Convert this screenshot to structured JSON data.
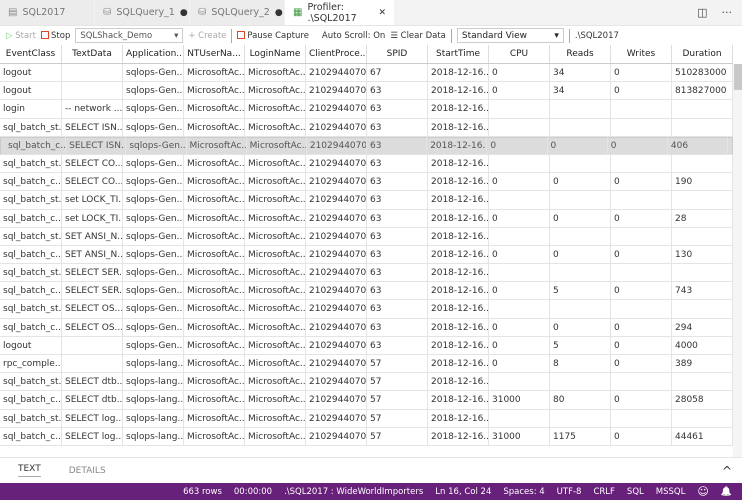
{
  "tabs": [
    {
      "label": "SQL2017",
      "icon": "database-icon",
      "dirty": false
    },
    {
      "label": "SQLQuery_1",
      "icon": "database-icon",
      "dirty": true
    },
    {
      "label": "SQLQuery_2",
      "icon": "database-icon",
      "dirty": true
    },
    {
      "label": "Profiler: .\\SQL2017",
      "icon": "grid-icon",
      "active": true
    }
  ],
  "tab_actions": {
    "split": "◫",
    "more": "···",
    "close": "✕",
    "dirty_dot": "●"
  },
  "toolbar": {
    "start": "Start",
    "stop": "Stop",
    "session": "SQLShack_Demo",
    "create": "Create",
    "pause": "Pause Capture",
    "autoscroll": "Auto Scroll: On",
    "clear": "Clear Data",
    "view": "Standard View",
    "server": ".\\SQL2017"
  },
  "columns": [
    "EventClass",
    "TextData",
    "Application...",
    "NTUserNa...",
    "LoginName",
    "ClientProce...",
    "SPID",
    "StartTime",
    "CPU",
    "Reads",
    "Writes",
    "Duration"
  ],
  "rows": [
    [
      "logout",
      "",
      "sqlops-Gen...",
      "MicrosoftAc...",
      "MicrosoftAc...",
      "2102944070",
      "67",
      "2018-12-16...",
      "0",
      "34",
      "0",
      "510283000"
    ],
    [
      "logout",
      "",
      "sqlops-Gen...",
      "MicrosoftAc...",
      "MicrosoftAc...",
      "2102944070",
      "63",
      "2018-12-16...",
      "0",
      "34",
      "0",
      "813827000"
    ],
    [
      "login",
      "-- network ...",
      "sqlops-Gen...",
      "MicrosoftAc...",
      "MicrosoftAc...",
      "2102944070",
      "63",
      "2018-12-16...",
      "",
      "",
      "",
      ""
    ],
    [
      "sql_batch_st...",
      "SELECT ISN...",
      "sqlops-Gen...",
      "MicrosoftAc...",
      "MicrosoftAc...",
      "2102944070",
      "63",
      "2018-12-16...",
      "",
      "",
      "",
      ""
    ],
    [
      "sql_batch_c...",
      "SELECT ISN...",
      "sqlops-Gen...",
      "MicrosoftAc...",
      "MicrosoftAc...",
      "2102944070",
      "63",
      "2018-12-16...",
      "0",
      "0",
      "0",
      "406"
    ],
    [
      "sql_batch_st...",
      "SELECT CO...",
      "sqlops-Gen...",
      "MicrosoftAc...",
      "MicrosoftAc...",
      "2102944070",
      "63",
      "2018-12-16...",
      "",
      "",
      "",
      ""
    ],
    [
      "sql_batch_c...",
      "SELECT CO...",
      "sqlops-Gen...",
      "MicrosoftAc...",
      "MicrosoftAc...",
      "2102944070",
      "63",
      "2018-12-16...",
      "0",
      "0",
      "0",
      "190"
    ],
    [
      "sql_batch_st...",
      "set LOCK_TI...",
      "sqlops-Gen...",
      "MicrosoftAc...",
      "MicrosoftAc...",
      "2102944070",
      "63",
      "2018-12-16...",
      "",
      "",
      "",
      ""
    ],
    [
      "sql_batch_c...",
      "set LOCK_TI...",
      "sqlops-Gen...",
      "MicrosoftAc...",
      "MicrosoftAc...",
      "2102944070",
      "63",
      "2018-12-16...",
      "0",
      "0",
      "0",
      "28"
    ],
    [
      "sql_batch_st...",
      "SET ANSI_N...",
      "sqlops-Gen...",
      "MicrosoftAc...",
      "MicrosoftAc...",
      "2102944070",
      "63",
      "2018-12-16...",
      "",
      "",
      "",
      ""
    ],
    [
      "sql_batch_c...",
      "SET ANSI_N...",
      "sqlops-Gen...",
      "MicrosoftAc...",
      "MicrosoftAc...",
      "2102944070",
      "63",
      "2018-12-16...",
      "0",
      "0",
      "0",
      "130"
    ],
    [
      "sql_batch_st...",
      "SELECT SER...",
      "sqlops-Gen...",
      "MicrosoftAc...",
      "MicrosoftAc...",
      "2102944070",
      "63",
      "2018-12-16...",
      "",
      "",
      "",
      ""
    ],
    [
      "sql_batch_c...",
      "SELECT SER...",
      "sqlops-Gen...",
      "MicrosoftAc...",
      "MicrosoftAc...",
      "2102944070",
      "63",
      "2018-12-16...",
      "0",
      "5",
      "0",
      "743"
    ],
    [
      "sql_batch_st...",
      "SELECT OS...",
      "sqlops-Gen...",
      "MicrosoftAc...",
      "MicrosoftAc...",
      "2102944070",
      "63",
      "2018-12-16...",
      "",
      "",
      "",
      ""
    ],
    [
      "sql_batch_c...",
      "SELECT OS...",
      "sqlops-Gen...",
      "MicrosoftAc...",
      "MicrosoftAc...",
      "2102944070",
      "63",
      "2018-12-16...",
      "0",
      "0",
      "0",
      "294"
    ],
    [
      "logout",
      "",
      "sqlops-Gen...",
      "MicrosoftAc...",
      "MicrosoftAc...",
      "2102944070",
      "63",
      "2018-12-16...",
      "0",
      "5",
      "0",
      "4000"
    ],
    [
      "rpc_comple...",
      "",
      "sqlops-lang...",
      "MicrosoftAc...",
      "MicrosoftAc...",
      "2102944070",
      "57",
      "2018-12-16...",
      "0",
      "8",
      "0",
      "389"
    ],
    [
      "sql_batch_st...",
      "SELECT dtb....",
      "sqlops-lang...",
      "MicrosoftAc...",
      "MicrosoftAc...",
      "2102944070",
      "57",
      "2018-12-16...",
      "",
      "",
      "",
      ""
    ],
    [
      "sql_batch_c...",
      "SELECT dtb....",
      "sqlops-lang...",
      "MicrosoftAc...",
      "MicrosoftAc...",
      "2102944070",
      "57",
      "2018-12-16...",
      "31000",
      "80",
      "0",
      "28058"
    ],
    [
      "sql_batch_st...",
      "SELECT log....",
      "sqlops-lang...",
      "MicrosoftAc...",
      "MicrosoftAc...",
      "2102944070",
      "57",
      "2018-12-16...",
      "",
      "",
      "",
      ""
    ],
    [
      "sql_batch_c...",
      "SELECT log....",
      "sqlops-lang...",
      "MicrosoftAc...",
      "MicrosoftAc...",
      "2102944070",
      "57",
      "2018-12-16...",
      "31000",
      "1175",
      "0",
      "44461"
    ]
  ],
  "selected_row": 4,
  "panel": {
    "tab_text": "TEXT",
    "tab_details": "DETAILS",
    "collapse": "^"
  },
  "status": {
    "rows": "663 rows",
    "time": "00:00:00",
    "connection": ".\\SQL2017 : WideWorldImporters",
    "position": "Ln 16, Col 24",
    "spaces": "Spaces: 4",
    "encoding": "UTF-8",
    "eol": "CRLF",
    "language": "SQL",
    "provider": "MSSQL",
    "feedback": "☺",
    "bell": "🔔"
  },
  "colors": {
    "status_bar": "#68217a",
    "stop": "#e0452a",
    "selection": "#dcdcdc"
  }
}
